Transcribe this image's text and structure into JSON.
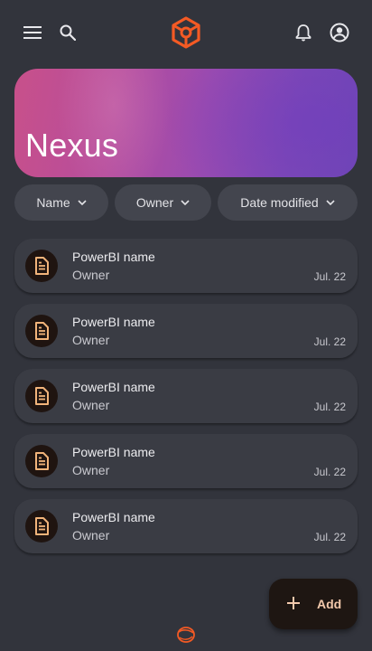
{
  "app": {
    "title": "Nexus",
    "accent_color": "#f45a24",
    "icon_color": "#f2b47a"
  },
  "topbar": {
    "menu_icon": "menu-icon",
    "search_icon": "search-icon",
    "logo_icon": "hexagon-logo-icon",
    "notifications_icon": "bell-icon",
    "account_icon": "account-circle-icon"
  },
  "filters": [
    {
      "label": "Name",
      "icon": "chevron-down-icon"
    },
    {
      "label": "Owner",
      "icon": "chevron-down-icon"
    },
    {
      "label": "Date modified",
      "icon": "chevron-down-icon"
    }
  ],
  "files": [
    {
      "title": "PowerBI name",
      "owner": "Owner",
      "date": "Jul. 22",
      "icon": "document-icon"
    },
    {
      "title": "PowerBI name",
      "owner": "Owner",
      "date": "Jul. 22",
      "icon": "document-icon"
    },
    {
      "title": "PowerBI name",
      "owner": "Owner",
      "date": "Jul. 22",
      "icon": "document-icon"
    },
    {
      "title": "PowerBI name",
      "owner": "Owner",
      "date": "Jul. 22",
      "icon": "document-icon"
    },
    {
      "title": "PowerBI name",
      "owner": "Owner",
      "date": "Jul. 22",
      "icon": "document-icon"
    }
  ],
  "fab": {
    "label": "Add",
    "icon": "plus-icon"
  },
  "footer": {
    "logo_icon": "orbit-logo-icon"
  }
}
